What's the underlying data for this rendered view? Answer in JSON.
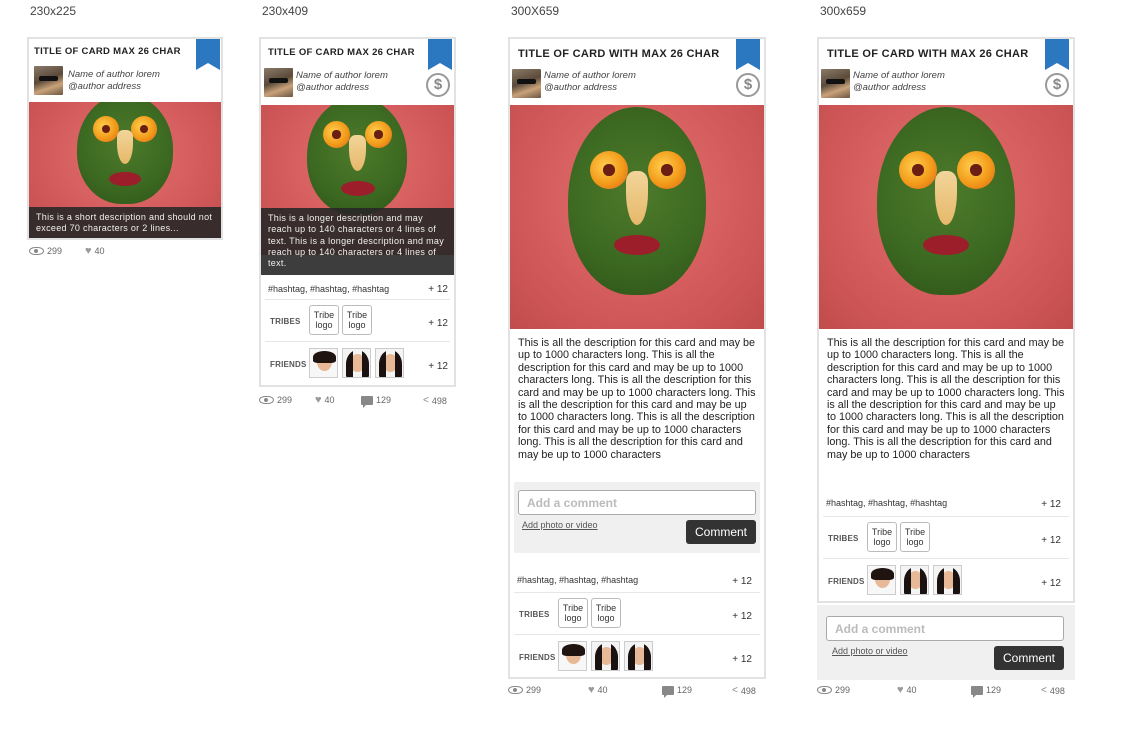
{
  "cards": [
    {
      "size_label": "230x225",
      "title": "TITLE OF CARD MAX 26 CHAR",
      "author_name": "Name of author lorem",
      "author_address": "@author address",
      "short_description": "This is a short description and should not exceed 70 characters or 2 lines...",
      "views": "299",
      "likes": "40"
    },
    {
      "size_label": "230x409",
      "title": "TITLE OF CARD MAX 26 CHAR",
      "author_name": "Name of author lorem",
      "author_address": "@author address",
      "currency_icon": "$",
      "long_description": "This is a longer description and may reach up to 140 characters or 4 lines of text. This is a longer description and may reach up to 140 characters or 4 lines of text.",
      "hashtags": "#hashtag,  #hashtag,  #hashtag",
      "hashtags_more": "+ 12",
      "tribes_label": "TRIBES",
      "tribe_logo": "Tribe logo",
      "tribes_more": "+ 12",
      "friends_label": "FRIENDS",
      "friends_more": "+ 12",
      "views": "299",
      "likes": "40",
      "comments": "129",
      "shares": "498"
    },
    {
      "size_label": "300X659",
      "title": "TITLE OF CARD WITH MAX 26 CHAR",
      "author_name": "Name of author lorem",
      "author_address": "@author address",
      "currency_icon": "$",
      "full_description": "This is all the description for this card and may be up to 1000 characters long. This is all the description for this card and may be up to 1000 characters long. This is all the description for this card and may be up to 1000 characters long. This is all the description for this card and may be up to 1000 characters long. This is all the description for this card and may be up to 1000 characters long. This is all the description for this card and may be up to 1000 characters",
      "comment_placeholder": "Add a comment",
      "add_media": "Add photo or video",
      "comment_button": "Comment",
      "hashtags": "#hashtag,  #hashtag,  #hashtag",
      "hashtags_more": "+ 12",
      "tribes_label": "TRIBES",
      "tribe_logo": "Tribe logo",
      "tribes_more": "+ 12",
      "friends_label": "FRIENDS",
      "friends_more": "+ 12",
      "views": "299",
      "likes": "40",
      "comments": "129",
      "shares": "498"
    },
    {
      "size_label": "300x659",
      "title": "TITLE OF CARD WITH MAX 26 CHAR",
      "author_name": "Name of author lorem",
      "author_address": "@author address",
      "currency_icon": "$",
      "full_description": "This is all the description for this card and may be up to 1000 characters long. This is all the description for this card and may be up to 1000 characters long. This is all the description for this card and may be up to 1000 characters long. This is all the description for this card and may be up to 1000 characters long. This is all the description for this card and may be up to 1000 characters long. This is all the description for this card and may be up to 1000 characters",
      "hashtags": "#hashtag,  #hashtag,  #hashtag",
      "hashtags_more": "+ 12",
      "tribes_label": "TRIBES",
      "tribe_logo": "Tribe logo",
      "tribes_more": "+ 12",
      "friends_label": "FRIENDS",
      "friends_more": "+ 12",
      "comment_placeholder": "Add a comment",
      "add_media": "Add photo or video",
      "comment_button": "Comment",
      "views": "299",
      "likes": "40",
      "comments": "129",
      "shares": "498"
    }
  ],
  "icons": {
    "views": "eye-icon",
    "likes": "heart-icon",
    "comments": "comment-icon",
    "shares": "share-icon",
    "ribbon": "bookmark-ribbon-icon",
    "currency": "dollar-icon"
  },
  "colors": {
    "ribbon": "#2b77c0",
    "overlay": "#333333",
    "hero_background": "#d35a5a",
    "comment_button": "#333333"
  }
}
